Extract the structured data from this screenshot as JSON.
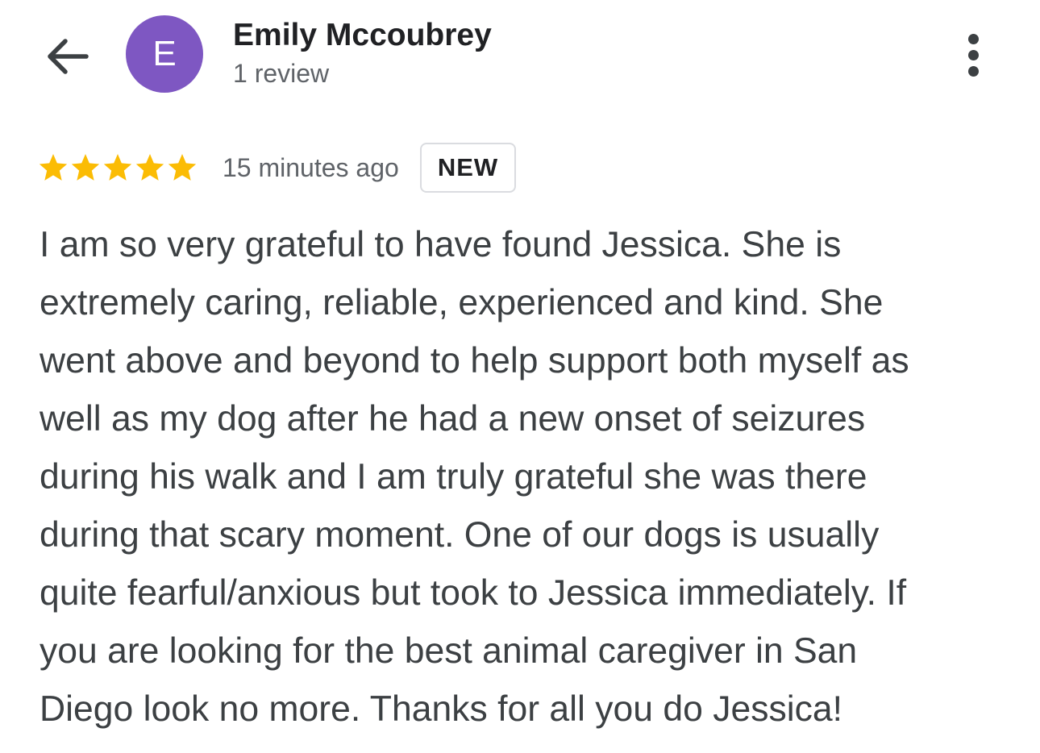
{
  "header": {
    "avatar_letter": "E",
    "avatar_color": "#7e57c2",
    "reviewer_name": "Emily Mccoubrey",
    "review_count": "1 review",
    "back_icon": "arrow-left-icon",
    "more_icon": "more-vertical-icon"
  },
  "review": {
    "rating": 5,
    "rating_max": 5,
    "star_color": "#fbbc04",
    "timestamp": "15 minutes ago",
    "badge": "NEW",
    "lines": [
      "I am so very grateful to have found Jessica. She is",
      "extremely caring, reliable, experienced and kind. She",
      "went above and beyond to help support both myself as",
      "well as my dog after he had a new onset of seizures",
      "during his walk and I am truly grateful she was there",
      "during that scary moment. One of our dogs is usually",
      "quite fearful/anxious but took to Jessica immediately. If",
      "you are looking for the best animal caregiver in San",
      "Diego look no more. Thanks for all you do Jessica!"
    ]
  }
}
